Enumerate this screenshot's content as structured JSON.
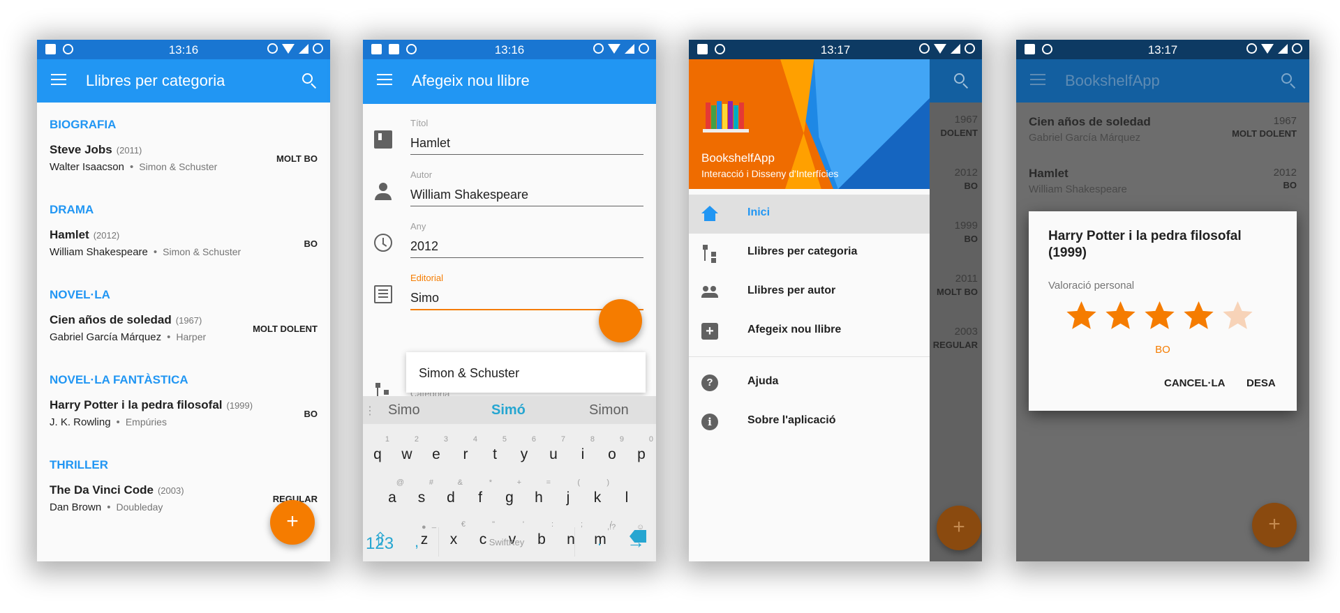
{
  "status": {
    "p1_time": "13:16",
    "p2_time": "13:16",
    "p3_time": "13:17",
    "p4_time": "13:17"
  },
  "colors": {
    "primary": "#2196f3",
    "primary_dark": "#1976d2",
    "accent": "#f57c00"
  },
  "screen1": {
    "title": "Llibres per categoria",
    "sections": [
      {
        "name": "BIOGRAFIA",
        "book": {
          "title": "Steve Jobs",
          "year": "(2011)",
          "author": "Walter Isaacson",
          "publisher": "Simon & Schuster",
          "rating": "MOLT BO"
        }
      },
      {
        "name": "DRAMA",
        "book": {
          "title": "Hamlet",
          "year": "(2012)",
          "author": "William Shakespeare",
          "publisher": "Simon & Schuster",
          "rating": "BO"
        }
      },
      {
        "name": "NOVEL·LA",
        "book": {
          "title": "Cien años de soledad",
          "year": "(1967)",
          "author": "Gabriel García Márquez",
          "publisher": "Harper",
          "rating": "MOLT DOLENT"
        }
      },
      {
        "name": "NOVEL·LA FANTÀSTICA",
        "book": {
          "title": "Harry Potter i la pedra filosofal",
          "year": "(1999)",
          "author": "J. K. Rowling",
          "publisher": "Empúries",
          "rating": "BO"
        }
      },
      {
        "name": "THRILLER",
        "book": {
          "title": "The Da Vinci Code",
          "year": "(2003)",
          "author": "Dan Brown",
          "publisher": "Doubleday",
          "rating": "REGULAR"
        }
      }
    ],
    "fab": "+"
  },
  "screen2": {
    "title": "Afegeix nou llibre",
    "fields": [
      {
        "label": "Títol",
        "value": "Hamlet",
        "icon": "book-icon"
      },
      {
        "label": "Autor",
        "value": "William Shakespeare",
        "icon": "person-icon"
      },
      {
        "label": "Any",
        "value": "2012",
        "icon": "clock-icon"
      },
      {
        "label": "Editorial",
        "value": "Simo",
        "icon": "library-icon"
      },
      {
        "label": "Categoria",
        "value": "",
        "icon": "category-tree-icon"
      }
    ],
    "suggestion": "Simon & Schuster",
    "keyboard": {
      "predictions": [
        "Simo",
        "Simó",
        "Simon"
      ],
      "row1": [
        [
          "q",
          "1"
        ],
        [
          "w",
          "2"
        ],
        [
          "e",
          "3"
        ],
        [
          "r",
          "4"
        ],
        [
          "t",
          "5"
        ],
        [
          "y",
          "6"
        ],
        [
          "u",
          "7"
        ],
        [
          "i",
          "8"
        ],
        [
          "o",
          "9"
        ],
        [
          "p",
          "0"
        ]
      ],
      "row2": [
        [
          "a",
          "@"
        ],
        [
          "s",
          "#"
        ],
        [
          "d",
          "&"
        ],
        [
          "f",
          "*"
        ],
        [
          "g",
          "+"
        ],
        [
          "h",
          "="
        ],
        [
          "j",
          "("
        ],
        [
          "k",
          ")"
        ],
        [
          "l",
          ""
        ]
      ],
      "row3": [
        [
          "z",
          "_"
        ],
        [
          "x",
          "€"
        ],
        [
          "c",
          "\""
        ],
        [
          "v",
          "'"
        ],
        [
          "b",
          ":"
        ],
        [
          "n",
          ";"
        ],
        [
          "m",
          "/"
        ]
      ],
      "numbers_key": "123",
      "comma": ",",
      "space_brand": "SwiftKey",
      "period": ".",
      "period_hint": ",!?"
    }
  },
  "screen3": {
    "app_name": "BookshelfApp",
    "subtitle": "Interacció i Disseny d'Interfícies",
    "menu": [
      {
        "label": "Inici",
        "icon": "home-icon",
        "active": true
      },
      {
        "label": "Llibres per categoria",
        "icon": "category-tree-icon",
        "active": false
      },
      {
        "label": "Llibres per autor",
        "icon": "people-icon",
        "active": false
      },
      {
        "label": "Afegeix nou llibre",
        "icon": "add-box-icon",
        "active": false
      },
      {
        "label": "Ajuda",
        "icon": "help-icon",
        "active": false
      },
      {
        "label": "Sobre l'aplicació",
        "icon": "info-icon",
        "active": false
      }
    ],
    "behind": [
      {
        "year": "1967",
        "rating": "DOLENT"
      },
      {
        "year": "2012",
        "rating": "BO"
      },
      {
        "year": "1999",
        "rating": "BO"
      },
      {
        "year": "2011",
        "rating": "MOLT BO"
      },
      {
        "year": "2003",
        "rating": "REGULAR"
      }
    ]
  },
  "screen4": {
    "title": "BookshelfApp",
    "list": [
      {
        "title": "Cien años de soledad",
        "author": "Gabriel García Márquez",
        "year": "1967",
        "rating": "MOLT DOLENT"
      },
      {
        "title": "Hamlet",
        "author": "William Shakespeare",
        "year": "2012",
        "rating": "BO"
      }
    ],
    "dialog": {
      "title": "Harry Potter i la pedra filosofal (1999)",
      "label": "Valoració personal",
      "stars_total": 5,
      "stars_filled": 4,
      "rating_text": "BO",
      "cancel": "CANCEL·LA",
      "save": "DESA"
    }
  }
}
